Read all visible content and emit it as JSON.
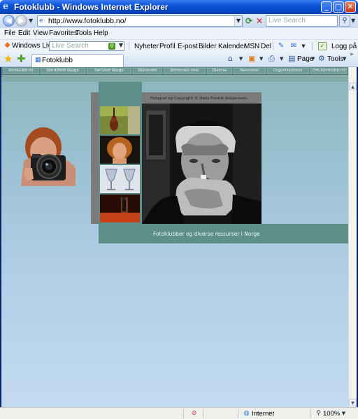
{
  "window": {
    "title": "Fotoklubb - Windows Internet Explorer",
    "min_glyph": "_",
    "max_glyph": "□",
    "close_glyph": "✕"
  },
  "address_bar": {
    "url": "http://www.fotoklubb.no/",
    "search_placeholder": "Live Search"
  },
  "menu": {
    "items": [
      "File",
      "Edit",
      "View",
      "Favorites",
      "Tools",
      "Help"
    ]
  },
  "live_toolbar": {
    "brand": "Windows Live",
    "search_placeholder": "Live Search",
    "links": [
      "Nyheter",
      "Profil",
      "E-post",
      "Bilder",
      "Kalender",
      "MSN",
      "Del"
    ],
    "login": "Logg på"
  },
  "tab_bar": {
    "tab_label": "Fotoklubb",
    "page_label": "Page",
    "tools_label": "Tools"
  },
  "site": {
    "nav_links": [
      "fotoklubb.no",
      "Nord/Midt Norge",
      "Sør/Vest Norge",
      "Østlandet",
      "Østlandet vest",
      "Diverse",
      "Ressurser",
      "Organisasjoner",
      "Om fotoklubb.no"
    ],
    "photo_credit": "Fotograf og Copyright © Hans Fredrik Asbjørnsen.",
    "caption": "Fotoklubber og diverse ressurser i Norge"
  },
  "status_bar": {
    "zone": "Internet",
    "zoom": "100%"
  },
  "colors": {
    "teal": "#5e8e8a",
    "titlebar": "#0a52d8"
  }
}
